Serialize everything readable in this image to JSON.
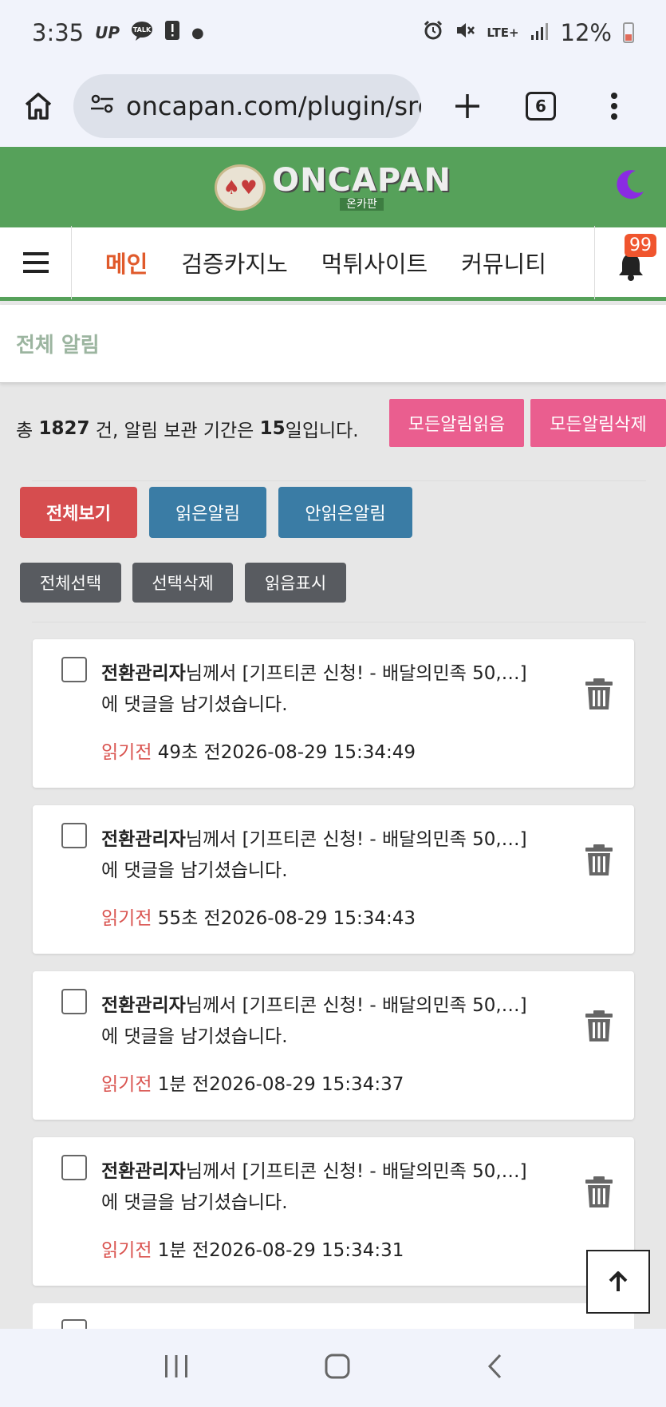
{
  "status_bar": {
    "time": "3:35",
    "left_icons": [
      "UP",
      "TALK"
    ],
    "network": "LTE+",
    "battery": "12%"
  },
  "browser": {
    "url": "oncapan.com/plugin/srd",
    "tab_count": "6"
  },
  "site": {
    "logo_text": "ONCAPAN",
    "logo_sub": "온카판"
  },
  "nav": {
    "items": [
      {
        "label": "메인",
        "active": true
      },
      {
        "label": "검증카지노",
        "active": false
      },
      {
        "label": "먹튀사이트",
        "active": false
      },
      {
        "label": "커뮤니티",
        "active": false
      }
    ],
    "bell_badge": "99"
  },
  "page": {
    "title": "전체 알림",
    "summary_prefix": "총 ",
    "total_count": "1827",
    "summary_mid": " 건, 알림 보관 기간은 ",
    "retention_days": "15",
    "summary_suffix": "일입니다.",
    "read_all_button": "모든알림읽음",
    "delete_all_button": "모든알림삭제"
  },
  "filters": {
    "all": "전체보기",
    "read": "읽은알림",
    "unread": "안읽은알림"
  },
  "actions": {
    "select_all": "전체선택",
    "delete_selected": "선택삭제",
    "mark_read": "읽음표시"
  },
  "notifications": [
    {
      "author": "전환관리자",
      "text_after_author": "님께서 [기프티콘 신청! - 배달의민족 50,…] 에 댓글을 남기셨습니다.",
      "status": "읽기전",
      "ago": "49초 전",
      "datetime": "2026-08-29 15:34:49"
    },
    {
      "author": "전환관리자",
      "text_after_author": "님께서 [기프티콘 신청! - 배달의민족 50,…] 에 댓글을 남기셨습니다.",
      "status": "읽기전",
      "ago": "55초 전",
      "datetime": "2026-08-29 15:34:43"
    },
    {
      "author": "전환관리자",
      "text_after_author": "님께서 [기프티콘 신청! - 배달의민족 50,…] 에 댓글을 남기셨습니다.",
      "status": "읽기전",
      "ago": "1분 전",
      "datetime": "2026-08-29 15:34:37"
    },
    {
      "author": "전환관리자",
      "text_after_author": "님께서 [기프티콘 신청! - 배달의민족 50,…] 에 댓글을 남기셨습니다.",
      "status": "읽기전",
      "ago": "1분 전",
      "datetime": "2026-08-29 15:34:31"
    }
  ],
  "colors": {
    "brand_green": "#56a15a",
    "nav_active": "#e05a2b",
    "pink_button": "#ea5e8f",
    "filter_active": "#d64d4f",
    "filter_blue": "#3a7ca5",
    "gray_button": "#585b60",
    "unread_text": "#d9534f"
  }
}
